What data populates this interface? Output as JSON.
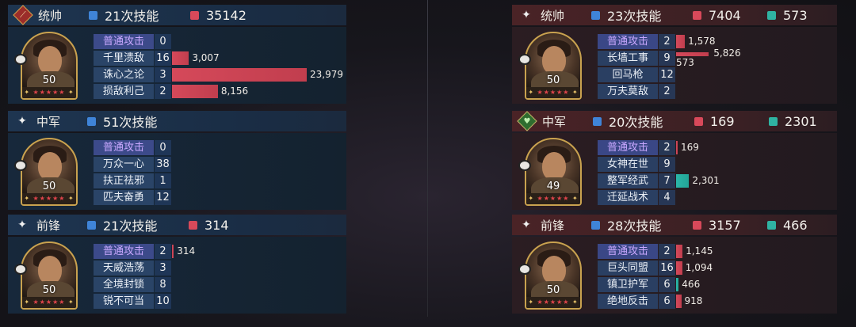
{
  "left": {
    "cards": [
      {
        "position_label": "统帅",
        "badge": "red",
        "badge_glyph": "⟋",
        "skill_total": "21次技能",
        "damage": "35142",
        "heal": "",
        "level": "50",
        "skills": [
          {
            "name": "普通攻击",
            "basic": true,
            "count": "0",
            "damage": null,
            "damage_label": "",
            "heal": null,
            "heal_label": ""
          },
          {
            "name": "千里溃敌",
            "basic": false,
            "count": "16",
            "damage": 3007,
            "damage_label": "3,007",
            "heal": null,
            "heal_label": ""
          },
          {
            "name": "诛心之论",
            "basic": false,
            "count": "3",
            "damage": 23979,
            "damage_label": "23,979",
            "heal": null,
            "heal_label": ""
          },
          {
            "name": "损敌利己",
            "basic": false,
            "count": "2",
            "damage": 8156,
            "damage_label": "8,156",
            "heal": null,
            "heal_label": ""
          }
        ]
      },
      {
        "position_label": "中军",
        "badge": "plain",
        "badge_glyph": "✦",
        "skill_total": "51次技能",
        "damage": "",
        "heal": "",
        "level": "50",
        "skills": [
          {
            "name": "普通攻击",
            "basic": true,
            "count": "0",
            "damage": null,
            "damage_label": "",
            "heal": null,
            "heal_label": ""
          },
          {
            "name": "万众一心",
            "basic": false,
            "count": "38",
            "damage": null,
            "damage_label": "",
            "heal": null,
            "heal_label": ""
          },
          {
            "name": "扶正祛邪",
            "basic": false,
            "count": "1",
            "damage": null,
            "damage_label": "",
            "heal": null,
            "heal_label": ""
          },
          {
            "name": "匹夫奋勇",
            "basic": false,
            "count": "12",
            "damage": null,
            "damage_label": "",
            "heal": null,
            "heal_label": ""
          }
        ]
      },
      {
        "position_label": "前锋",
        "badge": "plain",
        "badge_glyph": "✦",
        "skill_total": "21次技能",
        "damage": "314",
        "heal": "",
        "level": "50",
        "skills": [
          {
            "name": "普通攻击",
            "basic": true,
            "count": "2",
            "damage": 314,
            "damage_label": "314",
            "heal": null,
            "heal_label": ""
          },
          {
            "name": "天威浩荡",
            "basic": false,
            "count": "3",
            "damage": null,
            "damage_label": "",
            "heal": null,
            "heal_label": ""
          },
          {
            "name": "全境封锁",
            "basic": false,
            "count": "8",
            "damage": null,
            "damage_label": "",
            "heal": null,
            "heal_label": ""
          },
          {
            "name": "锐不可当",
            "basic": false,
            "count": "10",
            "damage": null,
            "damage_label": "",
            "heal": null,
            "heal_label": ""
          }
        ]
      }
    ]
  },
  "right": {
    "cards": [
      {
        "position_label": "统帅",
        "badge": "plain",
        "badge_glyph": "✦",
        "skill_total": "23次技能",
        "damage": "7404",
        "heal": "573",
        "level": "50",
        "skills": [
          {
            "name": "普通攻击",
            "basic": true,
            "count": "2",
            "damage": 1578,
            "damage_label": "1,578",
            "heal": null,
            "heal_label": ""
          },
          {
            "name": "长墙工事",
            "basic": false,
            "count": "9",
            "damage": 5826,
            "damage_label": "5,826",
            "heal": 573,
            "heal_label": "573"
          },
          {
            "name": "回马枪",
            "basic": false,
            "count": "12",
            "damage": null,
            "damage_label": "",
            "heal": null,
            "heal_label": ""
          },
          {
            "name": "万夫莫敌",
            "basic": false,
            "count": "2",
            "damage": null,
            "damage_label": "",
            "heal": null,
            "heal_label": ""
          }
        ]
      },
      {
        "position_label": "中军",
        "badge": "green",
        "badge_glyph": "♥",
        "skill_total": "20次技能",
        "damage": "169",
        "heal": "2301",
        "level": "49",
        "skills": [
          {
            "name": "普通攻击",
            "basic": true,
            "count": "2",
            "damage": 169,
            "damage_label": "169",
            "heal": null,
            "heal_label": ""
          },
          {
            "name": "女神在世",
            "basic": false,
            "count": "9",
            "damage": null,
            "damage_label": "",
            "heal": null,
            "heal_label": ""
          },
          {
            "name": "整军经武",
            "basic": false,
            "count": "7",
            "damage": null,
            "damage_label": "",
            "heal": 2301,
            "heal_label": "2,301"
          },
          {
            "name": "迁延战术",
            "basic": false,
            "count": "4",
            "damage": null,
            "damage_label": "",
            "heal": null,
            "heal_label": ""
          }
        ]
      },
      {
        "position_label": "前锋",
        "badge": "plain",
        "badge_glyph": "✦",
        "skill_total": "28次技能",
        "damage": "3157",
        "heal": "466",
        "level": "50",
        "skills": [
          {
            "name": "普通攻击",
            "basic": true,
            "count": "2",
            "damage": 1145,
            "damage_label": "1,145",
            "heal": null,
            "heal_label": ""
          },
          {
            "name": "巨头同盟",
            "basic": false,
            "count": "16",
            "damage": 1094,
            "damage_label": "1,094",
            "heal": null,
            "heal_label": ""
          },
          {
            "name": "镇卫护军",
            "basic": false,
            "count": "6",
            "damage": null,
            "damage_label": "",
            "heal": 466,
            "heal_label": "466"
          },
          {
            "name": "绝地反击",
            "basic": false,
            "count": "6",
            "damage": 918,
            "damage_label": "918",
            "heal": null,
            "heal_label": ""
          }
        ]
      }
    ]
  }
}
